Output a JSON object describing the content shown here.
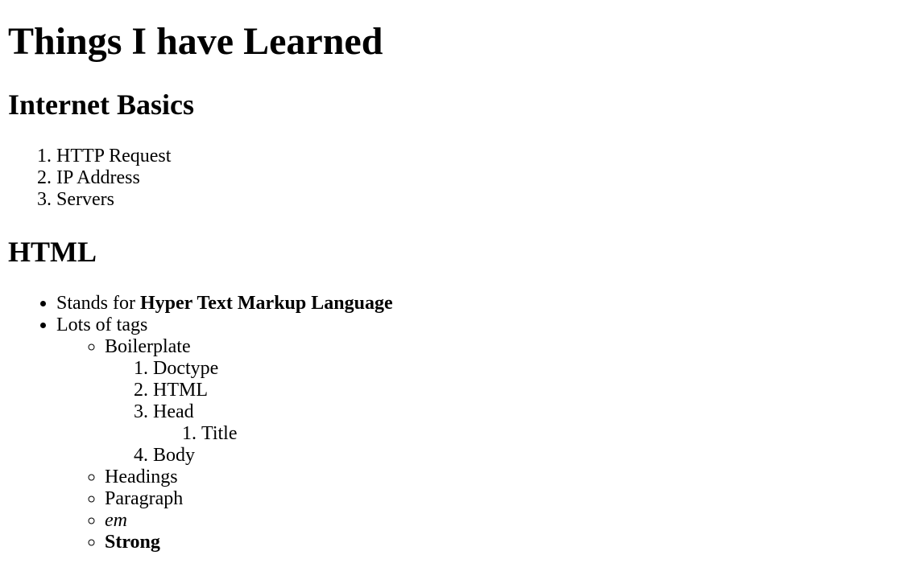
{
  "title": "Things I have Learned",
  "sections": [
    {
      "heading": "Internet Basics",
      "items": [
        "HTTP Request",
        "IP Address",
        "Servers"
      ]
    },
    {
      "heading": "HTML"
    }
  ],
  "html": {
    "stands_for_prefix": "Stands for ",
    "stands_for_bold": "Hyper Text Markup Language",
    "lots_of_tags": "Lots of tags",
    "boilerplate": "Boilerplate",
    "boilerplate_items": [
      "Doctype",
      "HTML",
      "Head",
      "Body"
    ],
    "head_items": [
      "Title"
    ],
    "tags": [
      "Headings",
      "Paragraph",
      "em",
      "Strong"
    ]
  }
}
